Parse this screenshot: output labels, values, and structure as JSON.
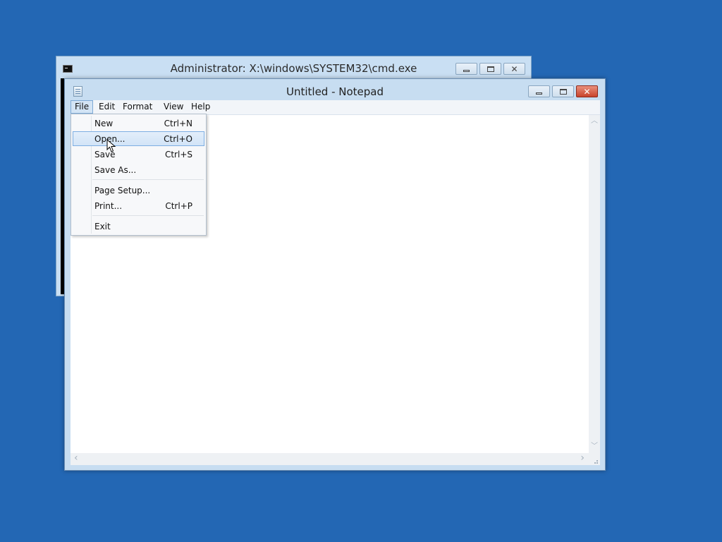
{
  "desktop": {
    "background_color": "#2367b4"
  },
  "cmd_window": {
    "title": "Administrator: X:\\windows\\SYSTEM32\\cmd.exe",
    "icon": "console-icon",
    "minimize_icon": "minimize-icon",
    "maximize_icon": "maximize-icon",
    "close_glyph": "✕"
  },
  "notepad_window": {
    "title": "Untitled - Notepad",
    "icon": "notepad-icon",
    "close_glyph": "✕",
    "menubar": {
      "items": [
        {
          "label": "File"
        },
        {
          "label": "Edit"
        },
        {
          "label": "Format"
        },
        {
          "label": "View"
        },
        {
          "label": "Help"
        }
      ]
    },
    "editor_text": "",
    "scroll_arrows": {
      "up": "︿",
      "down": "﹀",
      "left": "‹",
      "right": "›"
    }
  },
  "file_menu": {
    "items": [
      {
        "label": "New",
        "shortcut": "Ctrl+N"
      },
      {
        "label": "Open...",
        "shortcut": "Ctrl+O",
        "highlighted": true
      },
      {
        "label": "Save",
        "shortcut": "Ctrl+S"
      },
      {
        "label": "Save As...",
        "shortcut": ""
      },
      {
        "label": "Page Setup...",
        "shortcut": ""
      },
      {
        "label": "Print...",
        "shortcut": "Ctrl+P"
      },
      {
        "label": "Exit",
        "shortcut": ""
      }
    ]
  },
  "colors": {
    "title_bar": "#c7ddf1",
    "menu_highlight": "#d3e4f5",
    "close_button": "#c8432c"
  }
}
